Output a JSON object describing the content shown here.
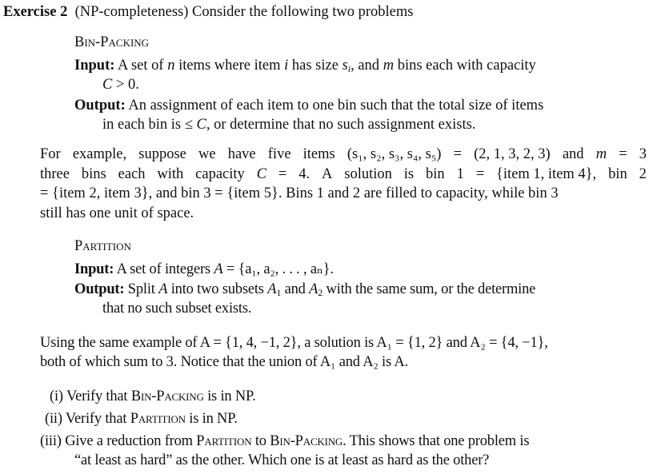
{
  "exercise": {
    "label": "Exercise 2",
    "topic": "(NP-completeness)",
    "intro": "Consider the following two problems"
  },
  "bin_packing": {
    "name": "Bin-Packing",
    "input_label": "Input:",
    "input_text_1": "A set of",
    "input_var_n": "n",
    "input_text_2": "items where item",
    "input_var_i": "i",
    "input_text_3": "has size",
    "input_var_s": "s",
    "input_sub_i": "i",
    "input_text_4": ", and",
    "input_var_m": "m",
    "input_text_5": "bins each with capacity",
    "input_cont_var": "C",
    "input_cont_text": " > 0.",
    "output_label": "Output:",
    "output_line1": "An assignment of each item to one bin such that the total size of items",
    "output_line2_a": "in each bin is ≤ ",
    "output_line2_var": "C",
    "output_line2_b": ", or determine that no such assignment exists."
  },
  "example1": {
    "line1": [
      "For",
      "example,",
      "suppose",
      "we",
      "have",
      "five",
      "items",
      "(s₁, s₂, s₃, s₄, s₅)",
      "=",
      "(2, 1, 3, 2, 3)",
      "and",
      "m",
      "=",
      "3"
    ],
    "line2": [
      "three",
      "bins",
      "each",
      "with",
      "capacity",
      "C",
      "=",
      "4.",
      "A",
      "solution",
      "is",
      "bin",
      "1",
      "=",
      "{item 1, item 4},",
      "bin",
      "2"
    ],
    "line3": "= {item 2, item 3}, and bin 3 = {item 5}. Bins 1 and 2 are filled to capacity, while bin 3",
    "line4": "still has one unit of space."
  },
  "partition": {
    "name": "Partition",
    "input_label": "Input:",
    "input_text": "A set of integers",
    "input_var": "A",
    "input_set": " = {a₁, a₂, . . . , aₙ}.",
    "output_label": "Output:",
    "output_a": "Split",
    "output_var_A": "A",
    "output_b": "into two subsets",
    "output_A1": "A",
    "output_A1_sub": "1",
    "output_c": "and",
    "output_A2": "A",
    "output_A2_sub": "2",
    "output_d": "with the same sum, or the determine",
    "output_line2": "that no such subset exists."
  },
  "example2": {
    "line1": "Using the same example of A = {1, 4, −1, 2}, a solution is A₁ = {1, 2} and A₂ = {4, −1},",
    "line2": "both of which sum to 3. Notice that the union of A₁ and A₂ is A."
  },
  "questions": [
    {
      "num": "(i)",
      "a": "Verify that",
      "sc": "Bin-Packing",
      "b": "is in NP."
    },
    {
      "num": "(ii)",
      "a": "Verify that",
      "sc": "Partition",
      "b": "is in NP."
    },
    {
      "num": "(iii)",
      "a": "Give a reduction from",
      "sc": "Partition",
      "mid": "to",
      "sc2": "Bin-Packing",
      "b": ". This shows that one problem is",
      "line2": "“at least as hard” as the other. Which one is at least as hard as the other?"
    }
  ]
}
